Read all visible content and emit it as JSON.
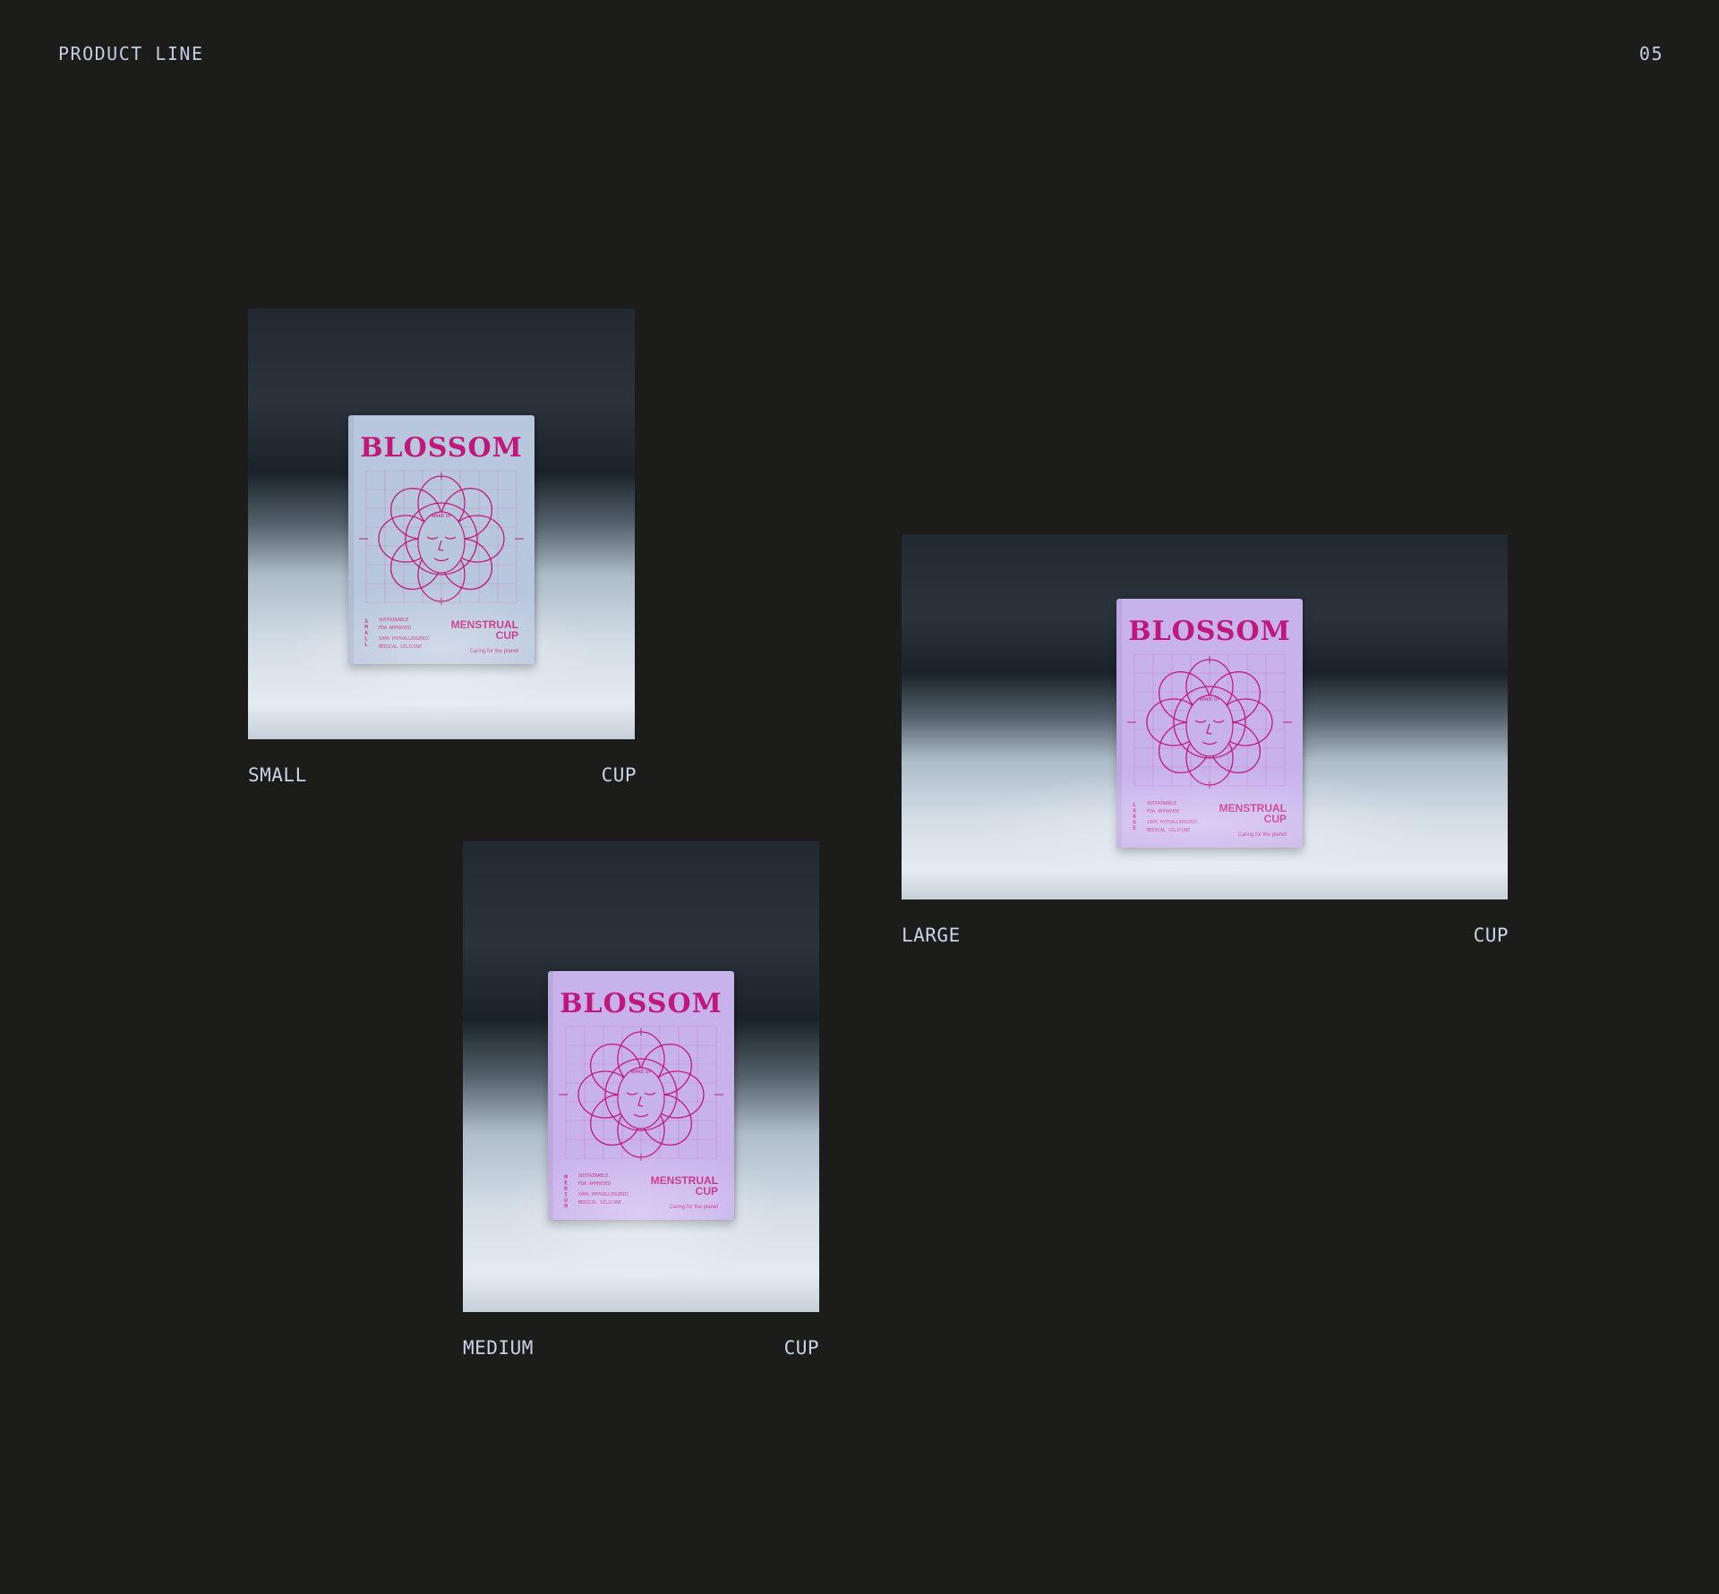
{
  "header": {
    "title": "PRODUCT LINE",
    "page_number": "05"
  },
  "colors": {
    "background": "#1c1c1b",
    "text": "#c9d4e6",
    "box_blue": "#b9c7dd",
    "box_lavender": "#c8b2ec",
    "brand_magenta": "#c0187a"
  },
  "products": [
    {
      "size": "SMALL",
      "type": "CUP",
      "box_color": "#b9c7dd",
      "box": {
        "brand": "BLOSSOM",
        "tagline": "WAKE UP",
        "vertical_size": "SMALL",
        "features": [
          "SUSTAINABLE",
          "FDA APPROVED",
          "100% HYPOALLERGENIC",
          "MEDICAL SILICONE"
        ],
        "product_name_1": "MENSTRUAL",
        "product_name_2": "CUP",
        "slogan": "Caring for the planet"
      }
    },
    {
      "size": "MEDIUM",
      "type": "CUP",
      "box_color": "#c8b2ec",
      "box": {
        "brand": "BLOSSOM",
        "tagline": "WAKE UP",
        "vertical_size": "MEDIUM",
        "features": [
          "SUSTAINABLE",
          "FDA APPROVED",
          "100% HYPOALLERGENIC",
          "MEDICAL SILICONE"
        ],
        "product_name_1": "MENSTRUAL",
        "product_name_2": "CUP",
        "slogan": "Caring for the planet"
      }
    },
    {
      "size": "LARGE",
      "type": "CUP",
      "box_color": "#c8b2ec",
      "box": {
        "brand": "BLOSSOM",
        "tagline": "WAKE UP",
        "vertical_size": "LARGE",
        "features": [
          "SUSTAINABLE",
          "FDA APPROVED",
          "100% HYPOALLERGENIC",
          "MEDICAL SILICONE"
        ],
        "product_name_1": "MENSTRUAL",
        "product_name_2": "CUP",
        "slogan": "Caring for the planet"
      }
    }
  ]
}
